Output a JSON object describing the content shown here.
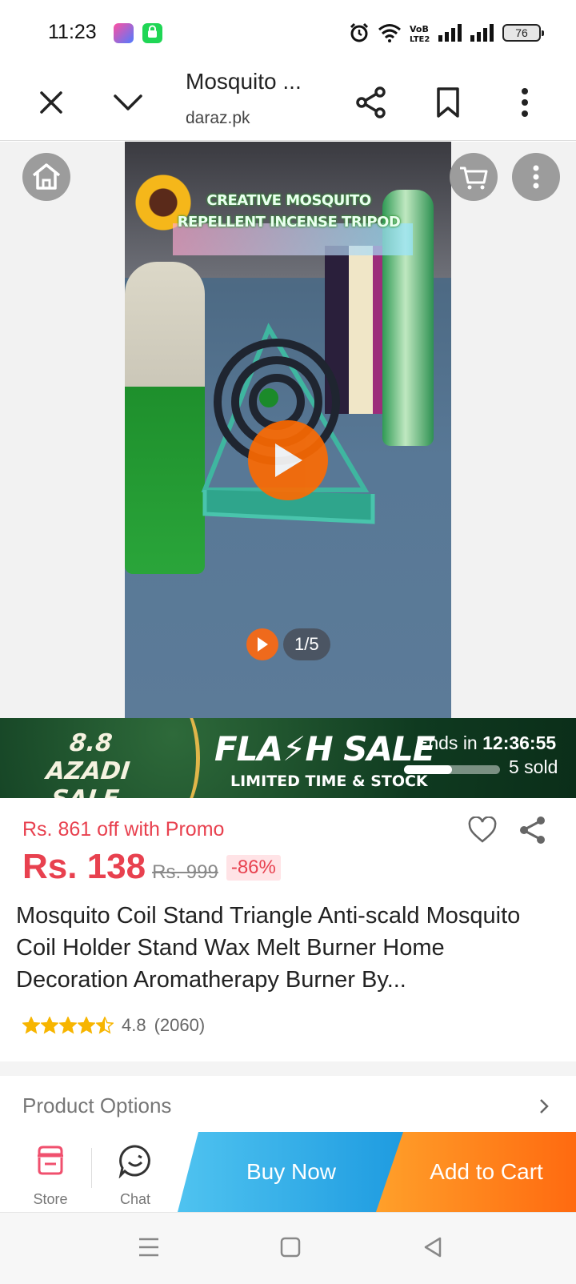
{
  "status_bar": {
    "time": "11:23",
    "battery": "76",
    "volte_label": "VoB LTE2"
  },
  "browser": {
    "title": "Mosquito ...",
    "url": "daraz.pk"
  },
  "media": {
    "video_caption_line1": "CREATIVE MOSQUITO",
    "video_caption_line2": "REPELLENT INCENSE TRIPOD",
    "counter": "1/5"
  },
  "flash_sale": {
    "campaign_line1": "8.8 AZADI",
    "campaign_line2": "SALE",
    "title": "FLA⚡H SALE",
    "subtitle": "LIMITED TIME & STOCK",
    "ends_label": "Ends in",
    "countdown": "12:36:55",
    "sold": "5 sold",
    "sold_fraction": 0.5
  },
  "product": {
    "promo": "Rs. 861 off with Promo",
    "price": "Rs. 138",
    "original_price": "Rs. 999",
    "discount": "-86%",
    "title": "Mosquito Coil Stand Triangle Anti-scald Mosquito Coil Holder Stand Wax Melt Burner Home Decoration Aromatherapy Burner By...",
    "rating": "4.8",
    "rating_count": "(2060)",
    "rating_stars": 4.5
  },
  "options": {
    "label": "Product Options"
  },
  "action_bar": {
    "store_label": "Store",
    "chat_label": "Chat",
    "buy_now": "Buy Now",
    "add_to_cart": "Add to Cart"
  },
  "colors": {
    "brand_orange": "#ff6a10",
    "price_red": "#e8414f",
    "buy_blue": "#1e9be0",
    "flash_green": "#0f3a20"
  }
}
